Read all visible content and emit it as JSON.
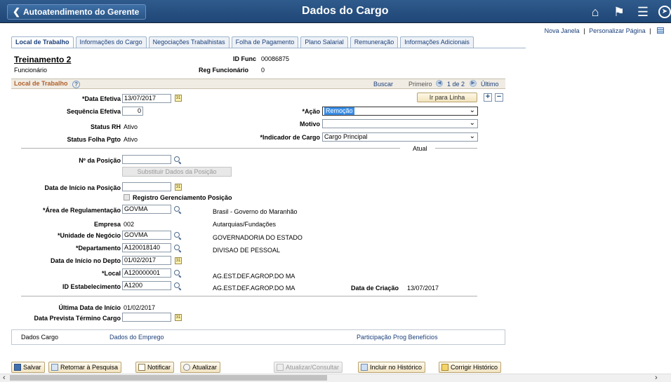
{
  "header": {
    "back_label": "Autoatendimento do Gerente",
    "title": "Dados do Cargo",
    "icons": [
      "home-icon",
      "flag-icon",
      "menu-icon",
      "compass-icon"
    ]
  },
  "top_links": {
    "new_window": "Nova Janela",
    "sep": "|",
    "personalize": "Personalizar Página",
    "sep2": "|"
  },
  "tabs": [
    {
      "label": "Local de Trabalho"
    },
    {
      "label": "Informações do Cargo"
    },
    {
      "label": "Negociações Trabalhistas"
    },
    {
      "label": "Folha de Pagamento"
    },
    {
      "label": "Plano Salarial"
    },
    {
      "label": "Remuneração"
    },
    {
      "label": "Informações Adicionais"
    }
  ],
  "employee": {
    "name": "Treinamento 2",
    "role": "Funcionário",
    "id_func_label": "ID Func",
    "id_func": "00086875",
    "reg_label": "Reg Funcionário",
    "reg": "0"
  },
  "section": {
    "title": "Local de Trabalho",
    "help": "?",
    "buscar": "Buscar",
    "primeiro": "Primeiro",
    "count": "1 de 2",
    "ultimo": "Último",
    "go_row": "Ir para Linha",
    "plus": "+",
    "minus": "−"
  },
  "fields": {
    "data_efetiva_label": "*Data Efetiva",
    "data_efetiva": "13/07/2017",
    "seq_label": "Sequência Efetiva",
    "seq": "0",
    "acao_label": "*Ação",
    "acao": "Remoção",
    "motivo_label": "Motivo",
    "motivo": "",
    "status_rh_label": "Status RH",
    "status_rh": "Ativo",
    "status_folha_label": "Status Folha Pgto",
    "status_folha": "Ativo",
    "indicador_label": "*Indicador de Cargo",
    "indicador": "Cargo Principal",
    "atual": "Atual",
    "posicao_label": "Nº da Posição",
    "posicao": "",
    "substituir": "Substituir Dados da Posição",
    "inicio_posicao_label": "Data de Início na Posição",
    "inicio_posicao": "",
    "registro_label": "Registro Gerenciamento Posição",
    "area_label": "*Área de Regulamentação",
    "area": "GOVMA",
    "area_desc": "Brasil - Governo do Maranhão",
    "empresa_label": "Empresa",
    "empresa": "002",
    "empresa_desc": "Autarquias/Fundações",
    "unidade_label": "*Unidade de Negócio",
    "unidade": "GOVMA",
    "unidade_desc": "GOVERNADORIA DO ESTADO",
    "depto_label": "*Departamento",
    "depto": "A120018140",
    "depto_desc": "DIVISAO DE PESSOAL",
    "inicio_depto_label": "Data de Início no Depto",
    "inicio_depto": "01/02/2017",
    "local_label": "*Local",
    "local": "A120000001",
    "local_desc": "AG.EST.DEF.AGROP.DO MA",
    "estab_label": "ID Estabelecimento",
    "estab": "A1200",
    "estab_desc": "AG.EST.DEF.AGROP.DO MA",
    "criacao_label": "Data de Criação",
    "criacao": "13/07/2017",
    "ultima_inicio_label": "Última Data de Início",
    "ultima_inicio": "01/02/2017",
    "termino_label": "Data Prevista Término Cargo",
    "termino": ""
  },
  "bottom_tabs": {
    "dados_cargo": "Dados Cargo",
    "dados_emprego": "Dados do Emprego",
    "participacao": "Participação Prog Benefícios"
  },
  "toolbar": {
    "salvar": "Salvar",
    "retornar": "Retornar à Pesquisa",
    "notificar": "Notificar",
    "atualizar": "Atualizar",
    "atualizar_consultar": "Atualizar/Consultar",
    "incluir": "Incluir no Histórico",
    "corrigir": "Corrigir Histórico"
  }
}
